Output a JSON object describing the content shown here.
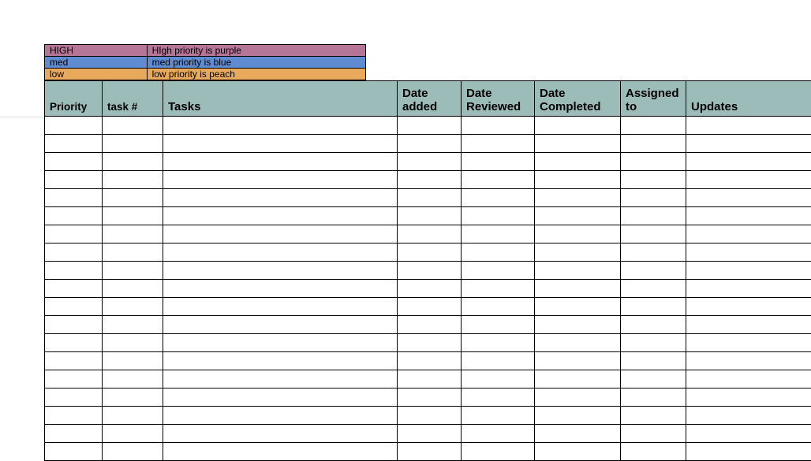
{
  "legend": [
    {
      "label": "HIGH",
      "desc": "HIgh priority is purple",
      "cls": "lg-high"
    },
    {
      "label": "med",
      "desc": "med priority is blue",
      "cls": "lg-med"
    },
    {
      "label": "low",
      "desc": "low priority is peach",
      "cls": "lg-low"
    }
  ],
  "columns": [
    {
      "label": "Priority",
      "cls": "c-prio",
      "big": false
    },
    {
      "label": "task #",
      "cls": "c-task",
      "big": false
    },
    {
      "label": "Tasks",
      "cls": "c-tasks",
      "big": true
    },
    {
      "label": "Date added",
      "cls": "c-added",
      "big": true
    },
    {
      "label": "Date Reviewed",
      "cls": "c-rev",
      "big": true
    },
    {
      "label": "Date Completed",
      "cls": "c-comp",
      "big": true
    },
    {
      "label": "Assigned to",
      "cls": "c-assn",
      "big": true
    },
    {
      "label": "Updates",
      "cls": "c-upd",
      "big": true
    }
  ],
  "blank_rows": 19
}
